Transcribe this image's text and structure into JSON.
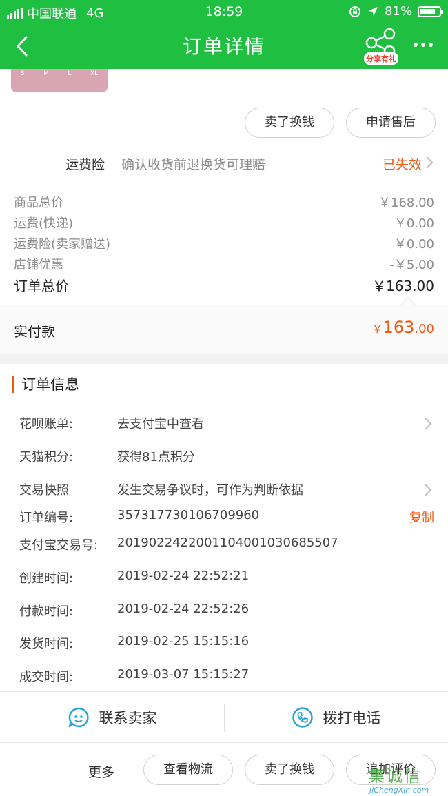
{
  "status_bar": {
    "carrier": "中国联通",
    "network": "4G",
    "time": "18:59",
    "battery": "81%",
    "battery_level": 0.81
  },
  "header": {
    "title": "订单详情",
    "share_badge": "分享有礼"
  },
  "product_thumb": {
    "sizes": [
      "S",
      "M",
      "L",
      "XL"
    ]
  },
  "actions_top": {
    "sell_label": "卖了换钱",
    "aftersale_label": "申请售后"
  },
  "freight_insurance": {
    "label": "运费险",
    "description": "确认收货前退换货可理赔",
    "status": "已失效"
  },
  "price_breakdown": [
    {
      "key": "商品总价",
      "value": "￥168.00"
    },
    {
      "key": "运费(快递)",
      "value": "￥0.00"
    },
    {
      "key": "运费险(卖家赠送)",
      "value": "￥0.00"
    },
    {
      "key": "店铺优惠",
      "value": "-￥5.00"
    }
  ],
  "order_total": {
    "key": "订单总价",
    "value": "￥163.00"
  },
  "paid": {
    "key": "实付款",
    "currency": "￥",
    "integer": "163",
    "decimal": ".00"
  },
  "order_info": {
    "title": "订单信息",
    "rows": [
      {
        "key": "花呗账单:",
        "value": "去支付宝中查看"
      },
      {
        "key": "天猫积分:",
        "value": "获得81点积分"
      },
      {
        "key": "交易快照",
        "value": "发生交易争议时，可作为判断依据"
      },
      {
        "key": "订单编号:",
        "value": "357317730106709960",
        "action": "复制"
      },
      {
        "key": "支付宝交易号:",
        "value": "2019022422001104001030685507"
      },
      {
        "key": "创建时间:",
        "value": "2019-02-24 22:52:21"
      },
      {
        "key": "付款时间:",
        "value": "2019-02-24 22:52:26"
      },
      {
        "key": "发货时间:",
        "value": "2019-02-25 15:15:16"
      },
      {
        "key": "成交时间:",
        "value": "2019-03-07 15:15:27"
      }
    ]
  },
  "contact": {
    "seller_label": "联系卖家",
    "phone_label": "拨打电话"
  },
  "bottom_bar": {
    "more_label": "更多",
    "logistics_label": "查看物流",
    "sell_label": "卖了换钱",
    "review_label": "追加评价"
  },
  "watermark": {
    "text": "集诚信",
    "url": "JiChengXin.com"
  },
  "colors": {
    "brand_green": "#1fbf42",
    "accent_orange": "#f05a14",
    "icon_blue": "#27a3d8"
  }
}
